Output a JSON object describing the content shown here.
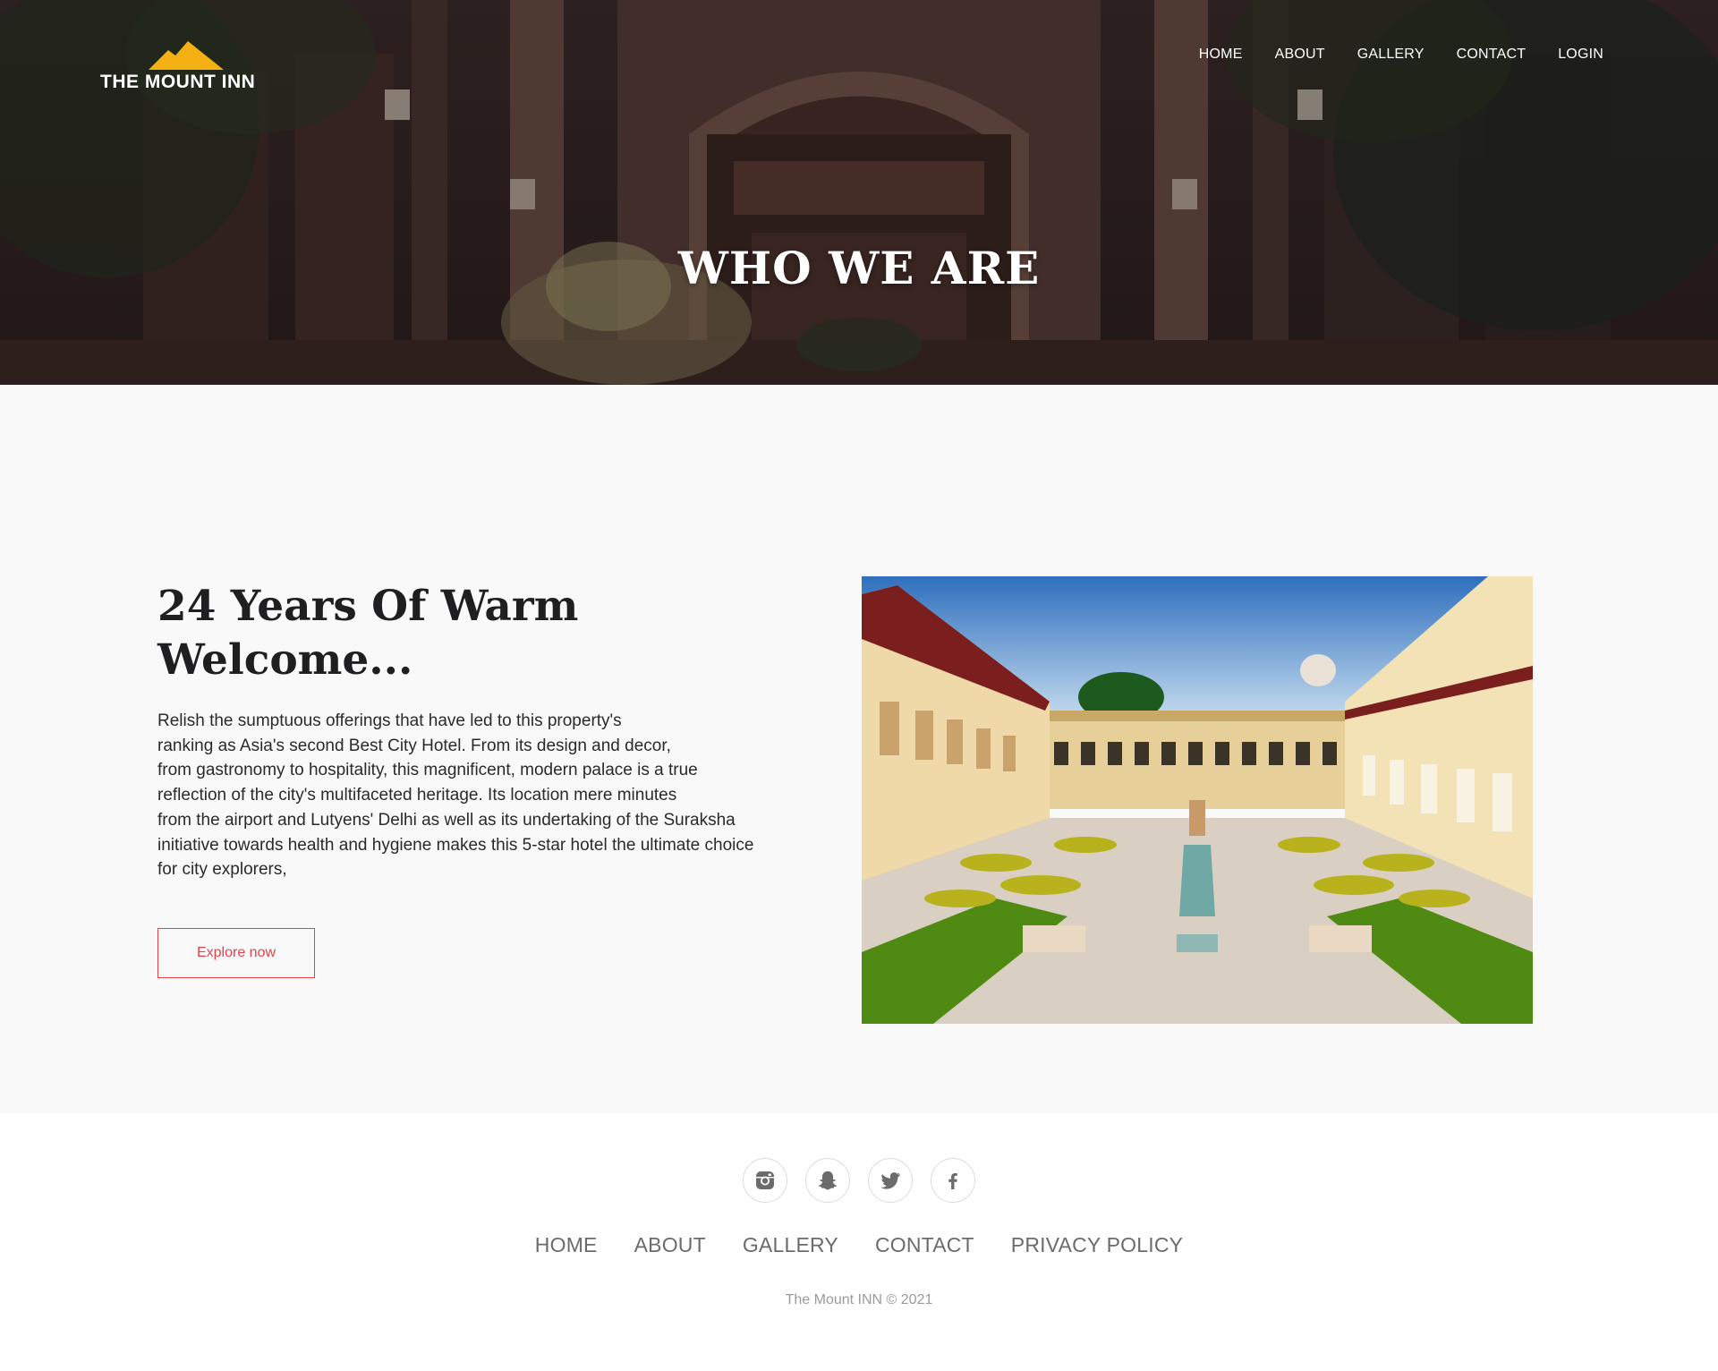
{
  "brand": {
    "name": "THE MOUNT INN",
    "logo_color": "#f5b014"
  },
  "nav": {
    "items": [
      "HOME",
      "ABOUT",
      "GALLERY",
      "CONTACT",
      "LOGIN"
    ]
  },
  "hero": {
    "title": "WHO WE ARE"
  },
  "about": {
    "title_line1": "24 Years Of Warm",
    "title_line2": "Welcome...",
    "lines": [
      "Relish the sumptuous offerings that have led to this property's",
      "ranking as Asia's second Best City Hotel. From its design and decor,",
      "from gastronomy to hospitality, this magnificent, modern palace is a true",
      "reflection of the city's multifaceted heritage. Its location mere minutes",
      "from the airport and Lutyens' Delhi as well as its undertaking of the Suraksha",
      "initiative towards health and hygiene makes this 5-star hotel the ultimate choice",
      "for city explorers,"
    ],
    "button_label": "Explore now",
    "accent_color": "#e0444a"
  },
  "footer": {
    "socials": [
      "instagram-icon",
      "snapchat-icon",
      "twitter-icon",
      "facebook-icon"
    ],
    "nav": [
      "HOME",
      "ABOUT",
      "GALLERY",
      "CONTACT",
      "PRIVACY POLICY"
    ],
    "copyright": "The Mount INN © 2021"
  }
}
